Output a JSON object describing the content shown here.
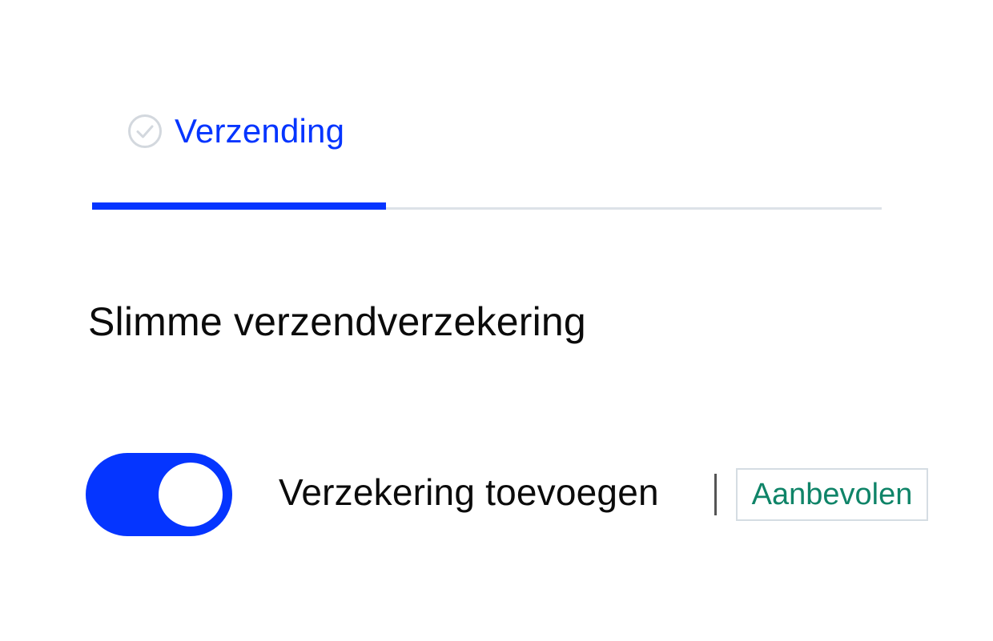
{
  "step": {
    "label": "Verzending",
    "icon": "check-circle-icon",
    "status": "completed",
    "progress_fraction": 0.37
  },
  "colors": {
    "accent": "#0535ff",
    "track": "#dde2e8",
    "badge_text": "#0f8468",
    "badge_border": "#d5dde3",
    "icon_gray": "#d3d8de"
  },
  "section": {
    "title": "Slimme verzendverzekering"
  },
  "insurance_option": {
    "toggle_on": true,
    "label": "Verzekering toevoegen",
    "badge": "Aanbevolen"
  }
}
